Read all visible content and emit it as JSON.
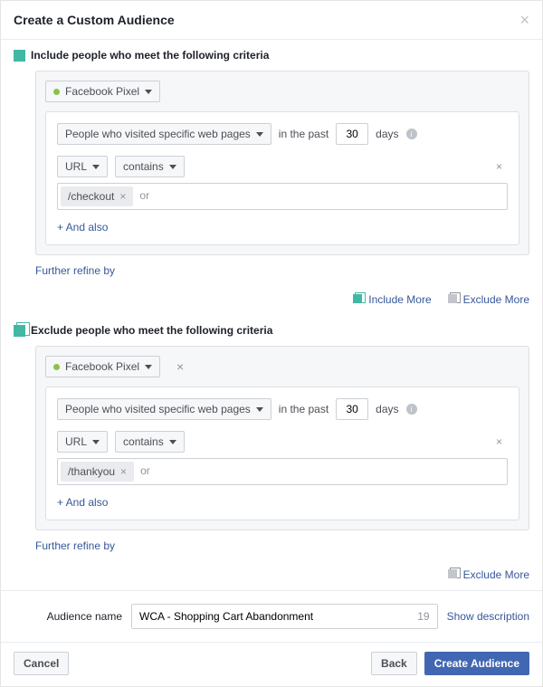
{
  "modal": {
    "title": "Create a Custom Audience"
  },
  "include": {
    "header": "Include people who meet the following criteria",
    "source_label": "Facebook Pixel",
    "visitor_type_label": "People who visited specific web pages",
    "past_prefix": "in the past",
    "past_value": "30",
    "past_suffix": "days",
    "url_field_label": "URL",
    "match_type_label": "contains",
    "tag_value": "/checkout",
    "or_text": "or",
    "and_also": "+ And also",
    "refine": "Further refine by"
  },
  "more_links": {
    "include": "Include More",
    "exclude": "Exclude More"
  },
  "exclude": {
    "header": "Exclude people who meet the following criteria",
    "source_label": "Facebook Pixel",
    "visitor_type_label": "People who visited specific web pages",
    "past_prefix": "in the past",
    "past_value": "30",
    "past_suffix": "days",
    "url_field_label": "URL",
    "match_type_label": "contains",
    "tag_value": "/thankyou",
    "or_text": "or",
    "and_also": "+ And also",
    "refine": "Further refine by"
  },
  "audience_name": {
    "label": "Audience name",
    "value": "WCA - Shopping Cart Abandonment",
    "char_count": "19",
    "show_description": "Show description"
  },
  "footer": {
    "cancel": "Cancel",
    "back": "Back",
    "create": "Create Audience"
  }
}
